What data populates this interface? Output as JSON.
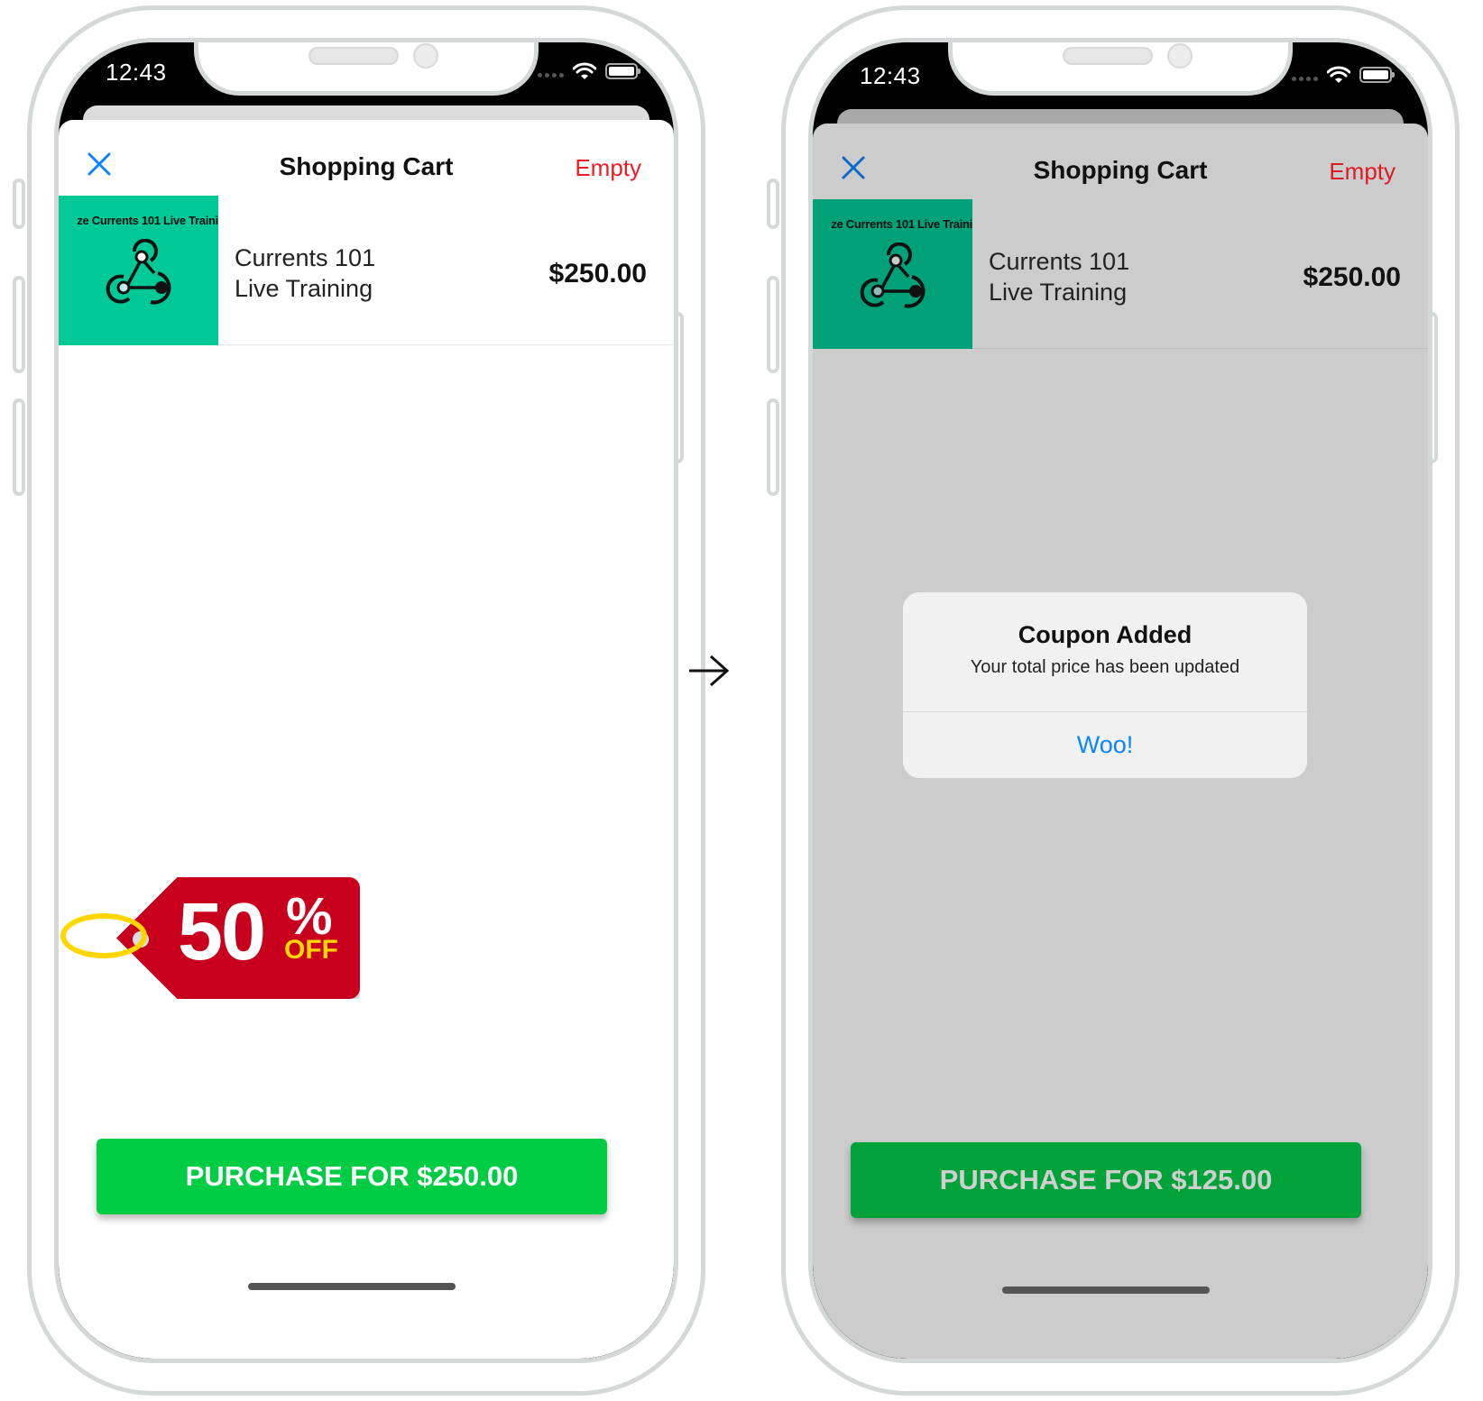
{
  "colors": {
    "accent_blue": "#0a84ff",
    "destructive_red": "#ee1c24",
    "purchase_green": "#00cc44",
    "thumbnail_teal": "#00c896",
    "tag_red": "#c8001e",
    "tag_yellow": "#ffd600"
  },
  "screens": [
    {
      "status_bar": {
        "time": "12:43",
        "icons": [
          "signal-dots-icon",
          "wifi-icon",
          "battery-icon"
        ]
      },
      "nav": {
        "close_icon": "close-icon",
        "title": "Shopping Cart",
        "empty_label": "Empty"
      },
      "cart_items": [
        {
          "thumbnail_caption": "ze Currents 101 Live Traini",
          "thumbnail_icon": "webhook-icon",
          "name_line1": "Currents 101",
          "name_line2": "Live Training",
          "price": "$250.00"
        }
      ],
      "sale_tag": {
        "amount": "50",
        "percent": "%",
        "off": "OFF"
      },
      "purchase_button": "PURCHASE FOR $250.00"
    },
    {
      "status_bar": {
        "time": "12:43",
        "icons": [
          "signal-dots-icon",
          "wifi-icon",
          "battery-icon"
        ]
      },
      "nav": {
        "close_icon": "close-icon",
        "title": "Shopping Cart",
        "empty_label": "Empty"
      },
      "cart_items": [
        {
          "thumbnail_caption": "ze Currents 101 Live Traini",
          "thumbnail_icon": "webhook-icon",
          "name_line1": "Currents 101",
          "name_line2": "Live Training",
          "price": "$250.00"
        }
      ],
      "alert": {
        "title": "Coupon Added",
        "message": "Your total price has been updated",
        "action": "Woo!"
      },
      "purchase_button": "PURCHASE FOR $125.00"
    }
  ],
  "transition_icon": "arrow-right-icon"
}
